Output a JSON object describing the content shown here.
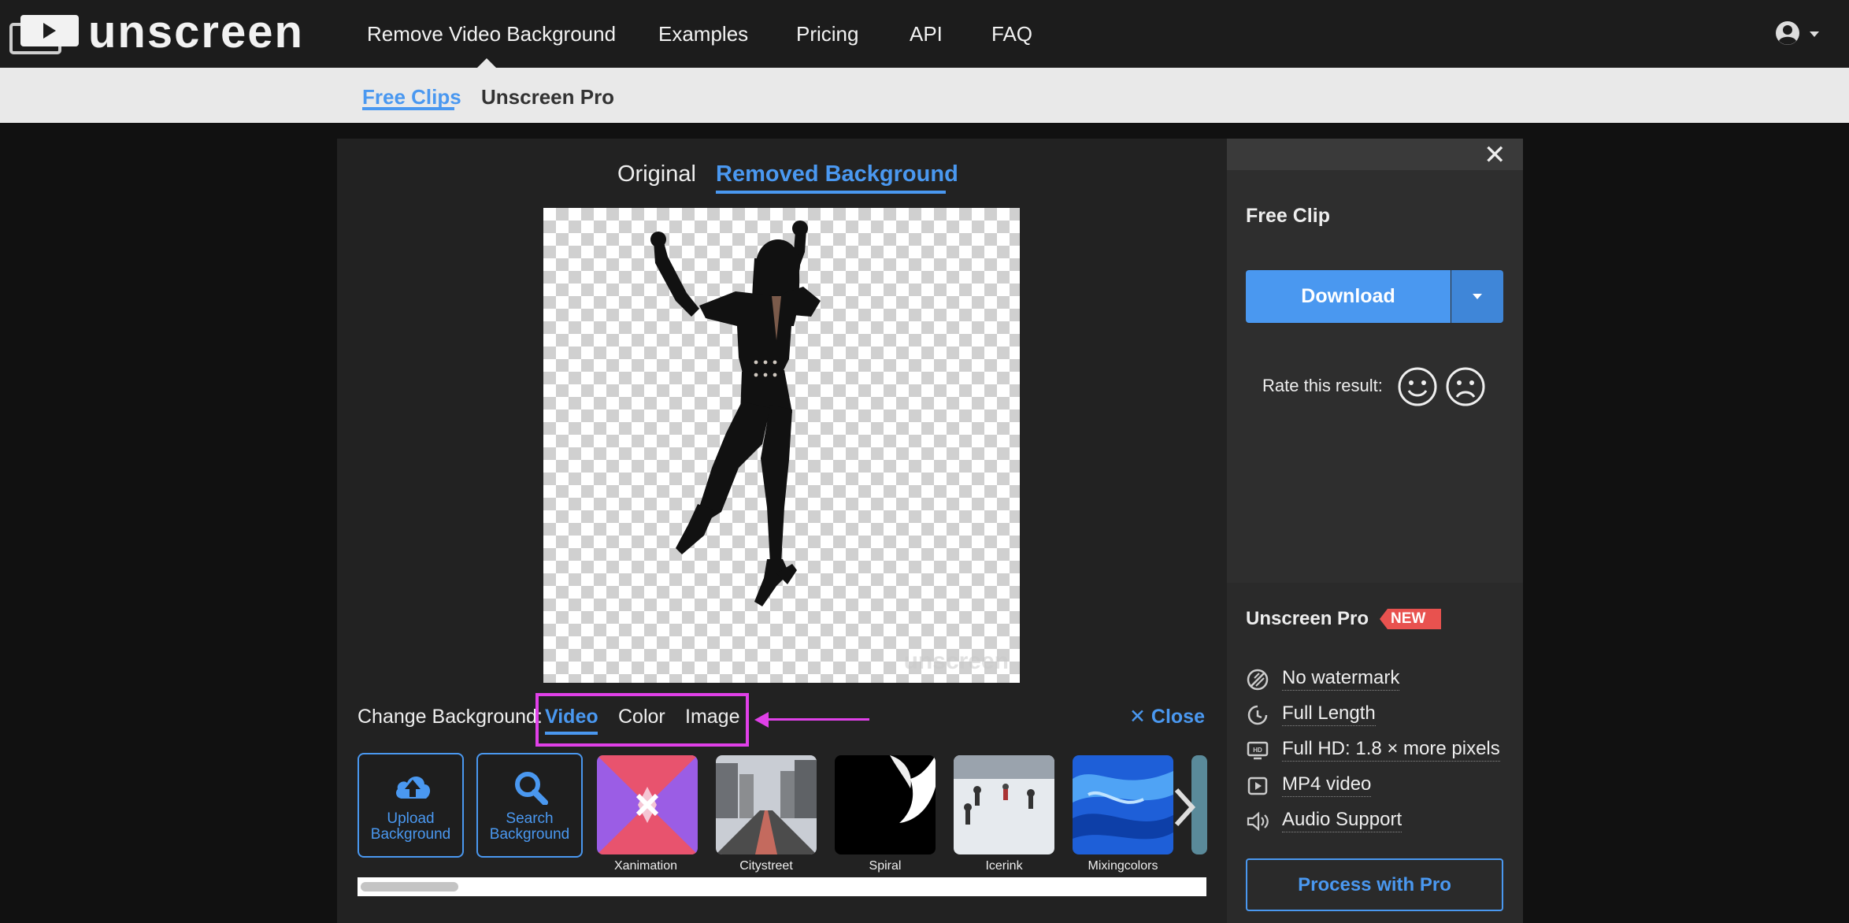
{
  "header": {
    "brand": "unscreen",
    "nav": [
      "Remove Video Background",
      "Examples",
      "Pricing",
      "API",
      "FAQ"
    ]
  },
  "subnav": {
    "items": [
      "Free Clips",
      "Unscreen Pro"
    ]
  },
  "viewer": {
    "tabs": [
      "Original",
      "Removed Background"
    ],
    "watermark": "unscreen"
  },
  "background_picker": {
    "label": "Change Background:",
    "tabs": [
      "Video",
      "Color",
      "Image"
    ],
    "close_label": "Close",
    "upload_label": "Upload Background",
    "search_label": "Search Background",
    "thumbnails": [
      "Xanimation",
      "Citystreet",
      "Spiral",
      "Icerink",
      "Mixingcolors"
    ]
  },
  "sidebar": {
    "title": "Free Clip",
    "download_label": "Download",
    "rate_label": "Rate this result:",
    "pro_title": "Unscreen Pro",
    "pro_badge": "NEW",
    "features": [
      "No watermark",
      "Full Length",
      "Full HD: 1.8 × more pixels",
      "MP4 video",
      "Audio Support"
    ],
    "pro_button": "Process with Pro"
  },
  "colors": {
    "accent": "#4a98f0",
    "highlight": "#e040e8",
    "badge": "#e8524f"
  }
}
